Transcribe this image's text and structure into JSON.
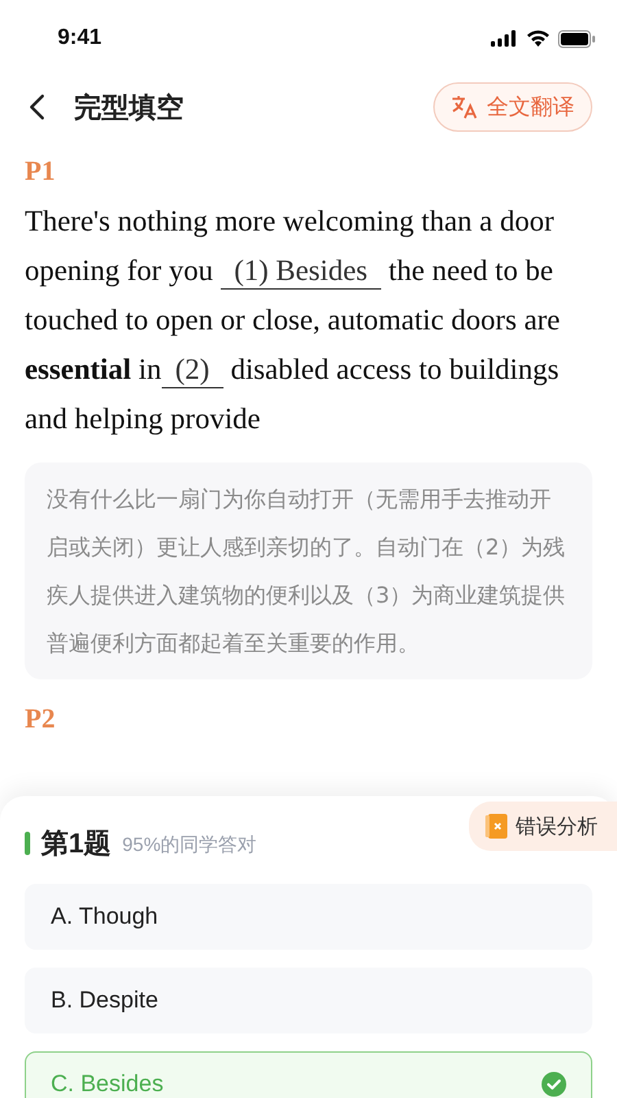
{
  "status_bar": {
    "time": "9:41"
  },
  "header": {
    "title": "完型填空",
    "translate_button": "全文翻译"
  },
  "passages": [
    {
      "label": "P1",
      "segments": [
        {
          "kind": "text",
          "text": "There's nothing more welcoming than a door opening for you "
        },
        {
          "kind": "blank",
          "text": "(1) Besides"
        },
        {
          "kind": "text",
          "text": " the need to be touched to open or close, automatic doors are **essential** in"
        },
        {
          "kind": "blank",
          "text": "(2)"
        },
        {
          "kind": "text",
          "text": " disabled access to buildings and helping provide"
        }
      ],
      "translation": "没有什么比一扇门为你自动打开（无需用手去推动开启或关闭）更让人感到亲切的了。自动门在（2）为残疾人提供进入建筑物的便利以及（3）为商业建筑提供普遍便利方面都起着至关重要的作用。"
    },
    {
      "label": "P2"
    }
  ],
  "question": {
    "title": "第1题",
    "stat": "95%的同学答对",
    "analysis_button": "错误分析",
    "options": [
      {
        "text": "A. Though",
        "selected": false
      },
      {
        "text": "B. Despite",
        "selected": false
      },
      {
        "text": "C. Besides",
        "selected": true
      }
    ]
  }
}
